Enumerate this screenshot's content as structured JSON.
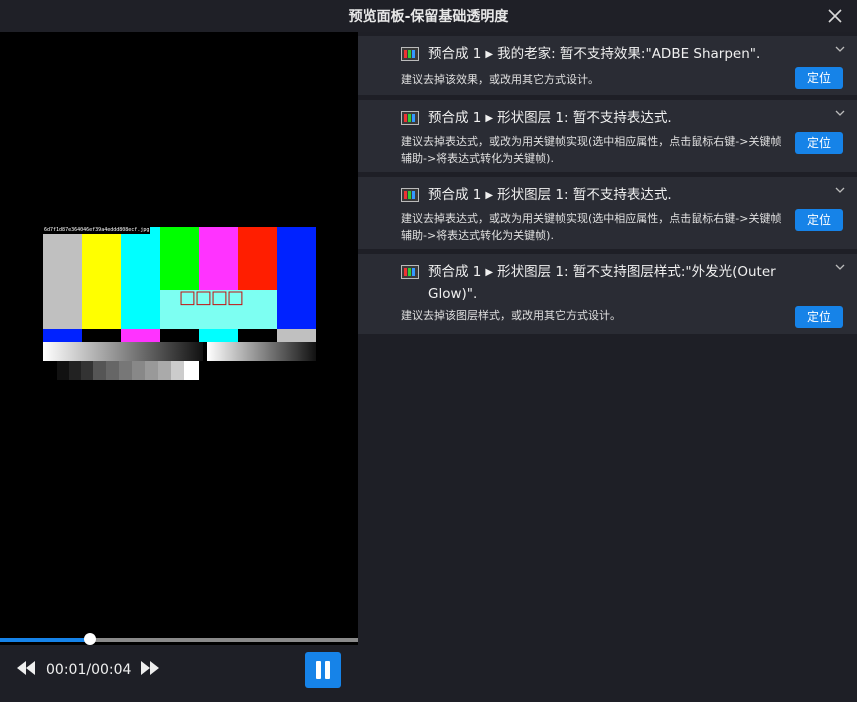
{
  "window": {
    "title": "预览面板-保留基础透明度"
  },
  "preview": {
    "hash_label": "6d7f1d87e364046ef39a4eddd808ecf.jpg",
    "missing_glyph_text": "□□□□",
    "progress_fraction": 0.25,
    "timecode": "00:01/00:04"
  },
  "warnings": [
    {
      "comp": "预合成 1",
      "arrow": "▶",
      "message": "我的老家: 暂不支持效果:\"ADBE Sharpen\".",
      "desc": "建议去掉该效果，或改用其它方式设计。",
      "locate": "定位"
    },
    {
      "comp": "预合成 1",
      "arrow": "▶",
      "message": "形状图层 1: 暂不支持表达式.",
      "desc": "建议去掉表达式，或改为用关键帧实现(选中相应属性，点击鼠标右键->关键帧辅助->将表达式转化为关键帧).",
      "locate": "定位"
    },
    {
      "comp": "预合成 1",
      "arrow": "▶",
      "message": "形状图层 1: 暂不支持表达式.",
      "desc": "建议去掉表达式，或改为用关键帧实现(选中相应属性，点击鼠标右键->关键帧辅助->将表达式转化为关键帧).",
      "locate": "定位"
    },
    {
      "comp": "预合成 1",
      "arrow": "▶",
      "message": "形状图层 1: 暂不支持图层样式:\"外发光(Outer Glow)\".",
      "desc": "建议去掉该图层样式，或改用其它方式设计。",
      "locate": "定位"
    }
  ],
  "colors": {
    "accent": "#1683e8",
    "panel_bg": "#1e1f26",
    "card_bg": "#2a2c34"
  }
}
